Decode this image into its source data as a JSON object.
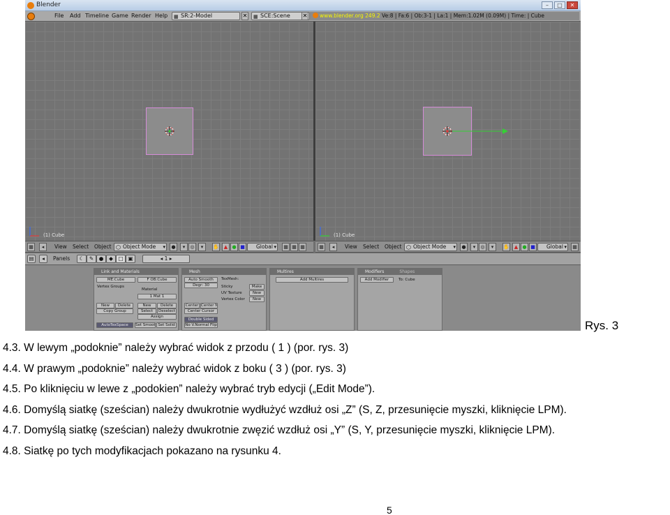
{
  "screenshot": {
    "window_title": "Blender",
    "menu": [
      "File",
      "Add",
      "Timeline",
      "Game",
      "Render",
      "Help"
    ],
    "screen_selector": "SR:2-Model",
    "scene_selector": "SCE:Scene",
    "info": {
      "url": "www.blender.org 249.2",
      "stats": "Ve:8 | Fa:6 | Ob:3-1 | La:1 | Mem:1.02M (0.09M) | Time: | Cube"
    },
    "left_viewport": {
      "label": "(1) Cube"
    },
    "right_viewport": {
      "label": "(1) Cube"
    },
    "view_header": {
      "view": "View",
      "select": "Select",
      "object": "Object",
      "mode": "Object Mode",
      "pivot": "Global"
    },
    "buttons_header": {
      "panels": "Panels",
      "frame": "1"
    },
    "panels": {
      "link_materials": {
        "title": "Link and Materials",
        "mesh_name": "ME:Cube",
        "object_name": "F OB:Cube",
        "vertex_groups": "Vertex Groups",
        "material": "Material",
        "mat_slot": "1 Mat 1",
        "new_l": "New",
        "delete_l": "Delete",
        "copy_group": "Copy Group",
        "new_r": "New",
        "delete_r": "Delete",
        "select": "Select",
        "deselect": "Deselect",
        "assign": "Assign",
        "autotexspace": "AutoTexSpace",
        "set_smooth": "Set Smooth",
        "set_solid": "Set Solid"
      },
      "mesh": {
        "title": "Mesh",
        "auto_smooth": "Auto Smooth",
        "degr": "Degr: 30",
        "texmesh": "TexMesh:",
        "sticky": "Sticky",
        "make": "Make",
        "uv_texture": "UV Texture",
        "new1": "New",
        "vertex_color": "Vertex Color",
        "new2": "New",
        "center": "Center",
        "center_new": "Center New",
        "center_cursor": "Center Cursor",
        "double_sided": "Double Sided",
        "no_vnormal_flip": "No V.Normal Flip"
      },
      "multires": {
        "title": "Multires",
        "add_multires": "Add Multires"
      },
      "modifiers": {
        "title": "Modifiers",
        "tab2": "Shapes",
        "add_modifier": "Add Modifier",
        "to": "To: Cube"
      }
    }
  },
  "caption": "Rys. 3",
  "steps": [
    "4.3. W lewym „podoknie” należy wybrać widok z przodu ( 1 ) (por. rys. 3)",
    "4.4. W prawym „podoknie” należy wybrać widok z boku ( 3 )  (por. rys. 3)",
    "4.5. Po kliknięciu w lewe z „podokien” należy wybrać tryb edycji („Edit Mode”).",
    "4.6. Domyślą siatkę (sześcian) należy dwukrotnie wydłużyć wzdłuż osi „Z” (S,  Z, przesunięcie myszki, kliknięcie LPM).",
    "4.7. Domyślą siatkę (sześcian) należy dwukrotnie zwęzić wzdłuż osi „Y” (S,  Y, przesunięcie myszki, kliknięcie LPM).",
    "4.8. Siatkę po tych modyfikacjach pokazano na rysunku 4."
  ],
  "page_number": "5",
  "colors": {
    "cube_edge": "#d58bd8",
    "x_axis": "#e03c3c",
    "y_axis": "#35d035",
    "z_axis": "#3a6cf0",
    "url": "#f6f600"
  }
}
